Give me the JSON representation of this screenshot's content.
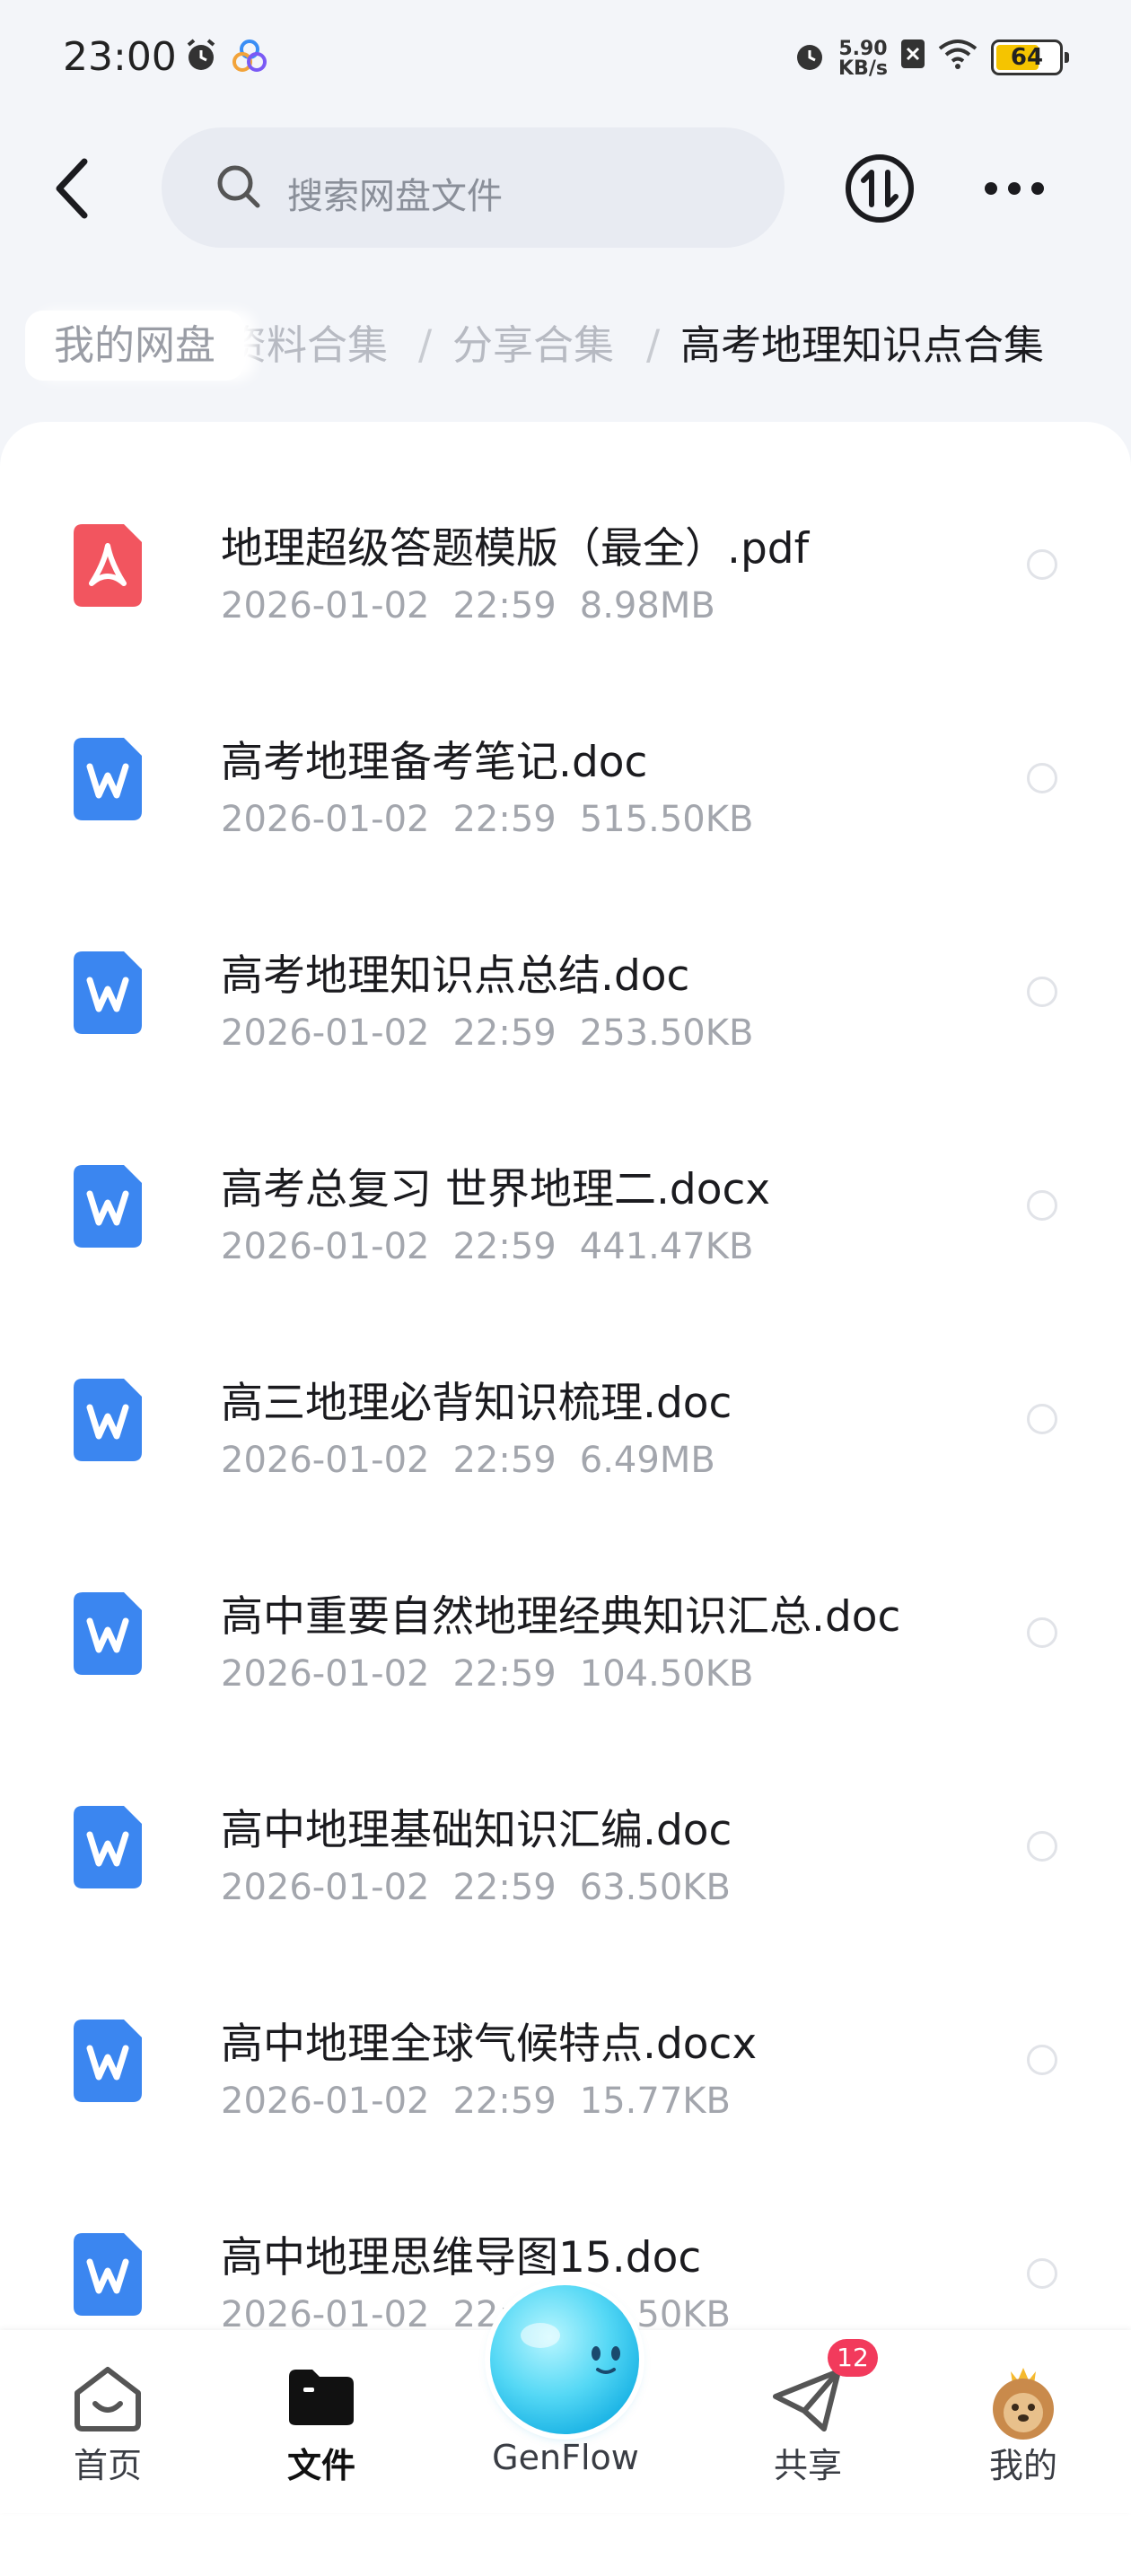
{
  "status_bar": {
    "time": "23:00",
    "net_speed_value": "5.90",
    "net_speed_unit": "KB/s",
    "battery": "64"
  },
  "top_bar": {
    "search_placeholder": "搜索网盘文件"
  },
  "breadcrumb": {
    "root": "我的网盘",
    "mid1": "资料合集",
    "separator": "/",
    "mid2": "分享合集",
    "current": "高考地理知识点合集"
  },
  "files": [
    {
      "name": "地理超级答题模版（最全）.pdf",
      "date": "2026-01-02",
      "time": "22:59",
      "size": "8.98MB",
      "type": "pdf"
    },
    {
      "name": "高考地理备考笔记.doc",
      "date": "2026-01-02",
      "time": "22:59",
      "size": "515.50KB",
      "type": "word"
    },
    {
      "name": "高考地理知识点总结.doc",
      "date": "2026-01-02",
      "time": "22:59",
      "size": "253.50KB",
      "type": "word"
    },
    {
      "name": "高考总复习 世界地理二.docx",
      "date": "2026-01-02",
      "time": "22:59",
      "size": "441.47KB",
      "type": "word"
    },
    {
      "name": "高三地理必背知识梳理.doc",
      "date": "2026-01-02",
      "time": "22:59",
      "size": "6.49MB",
      "type": "word"
    },
    {
      "name": "高中重要自然地理经典知识汇总.doc",
      "date": "2026-01-02",
      "time": "22:59",
      "size": "104.50KB",
      "type": "word"
    },
    {
      "name": "高中地理基础知识汇编.doc",
      "date": "2026-01-02",
      "time": "22:59",
      "size": "63.50KB",
      "type": "word"
    },
    {
      "name": "高中地理全球气候特点.docx",
      "date": "2026-01-02",
      "time": "22:59",
      "size": "15.77KB",
      "type": "word"
    },
    {
      "name": "高中地理思维导图15.doc",
      "date": "2026-01-02",
      "time": "22:59",
      "size": "19.50KB",
      "type": "word"
    }
  ],
  "bottom_nav": {
    "home": "首页",
    "files": "文件",
    "genflow": "GenFlow",
    "share": "共享",
    "share_badge": "12",
    "me": "我的"
  },
  "colors": {
    "pdf_icon": "#f2555f",
    "word_icon": "#3b86f0",
    "genflow_orb": "#3cc8ef",
    "badge": "#f23a5c",
    "battery_fill": "#f5c400"
  }
}
